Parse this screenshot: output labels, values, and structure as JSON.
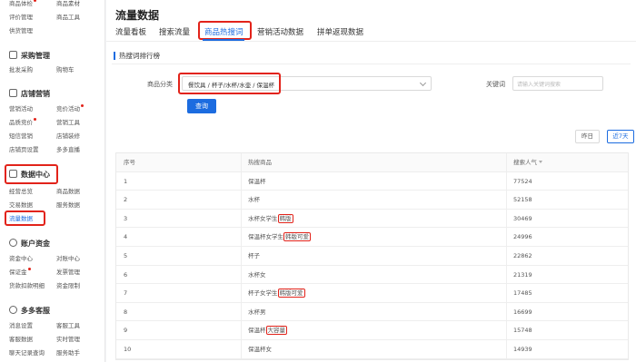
{
  "sidebar": {
    "top_items": [
      {
        "label": "商品体检",
        "dot": true
      },
      {
        "label": "商品素材",
        "dot": false
      },
      {
        "label": "评价管理",
        "dot": false
      },
      {
        "label": "商品工具",
        "dot": false
      },
      {
        "label": "供货管理",
        "dot": false
      }
    ],
    "groups": [
      {
        "title": "采购管理",
        "items": [
          "批发采购",
          "购物车"
        ]
      },
      {
        "title": "店铺营销",
        "items": [
          "营销活动",
          "竞价活动",
          "品质竞价",
          "营销工具",
          "短信营销",
          "店铺装修",
          "店铺页设置",
          "多多直播"
        ]
      },
      {
        "title": "数据中心",
        "items": [
          "经营总览",
          "商品数据",
          "交易数据",
          "服务数据",
          "流量数据"
        ]
      },
      {
        "title": "账户资金",
        "items": [
          "资金中心",
          "对账中心",
          "保证金",
          "发票管理",
          "货款扣款明细",
          "资金限制"
        ]
      },
      {
        "title": "多多客服",
        "items": [
          "消息设置",
          "客服工具",
          "客服数据",
          "实时管理",
          "聊天记录查询",
          "服务助手"
        ]
      }
    ]
  },
  "page": {
    "title": "流量数据",
    "tabs": [
      "流量看板",
      "搜索流量",
      "商品热搜词",
      "营销活动数据",
      "拼单返现数据"
    ],
    "section_title": "热搜词排行榜"
  },
  "filters": {
    "category_label": "商品分类",
    "category_value": "餐饮具 / 杯子/水杯/水壶 / 保温杯",
    "keyword_label": "关键词",
    "keyword_placeholder": "请输入关键词搜索",
    "query_button": "查询",
    "range_buttons": [
      "昨日",
      "近7天"
    ]
  },
  "table": {
    "headers": [
      "序号",
      "热搜商品",
      "搜索人气"
    ],
    "rows": [
      {
        "rank": "1",
        "parts": [
          "保温杯"
        ],
        "hl": "",
        "after": "",
        "pop": "77524"
      },
      {
        "rank": "2",
        "parts": [
          "水杯"
        ],
        "hl": "",
        "after": "",
        "pop": "52158"
      },
      {
        "rank": "3",
        "parts": [
          "水杯女学生"
        ],
        "hl": "韩版",
        "after": "",
        "pop": "30469"
      },
      {
        "rank": "4",
        "parts": [
          "保温杯女学生"
        ],
        "hl": "韩版可爱",
        "after": "",
        "pop": "24996"
      },
      {
        "rank": "5",
        "parts": [
          "杯子"
        ],
        "hl": "",
        "after": "",
        "pop": "22862"
      },
      {
        "rank": "6",
        "parts": [
          "水杯女"
        ],
        "hl": "",
        "after": "",
        "pop": "21319"
      },
      {
        "rank": "7",
        "parts": [
          "杯子女学生"
        ],
        "hl": "韩版可爱",
        "after": "",
        "pop": "17485"
      },
      {
        "rank": "8",
        "parts": [
          "水杯男"
        ],
        "hl": "",
        "after": "",
        "pop": "16699"
      },
      {
        "rank": "9",
        "parts": [
          "保温杯"
        ],
        "hl": "大容量",
        "after": "",
        "pop": "15748"
      },
      {
        "rank": "10",
        "parts": [
          "保温杯女"
        ],
        "hl": "",
        "after": "",
        "pop": "14939"
      }
    ]
  },
  "colors": {
    "accent": "#1c6ce0",
    "highlight": "#e2231a"
  }
}
